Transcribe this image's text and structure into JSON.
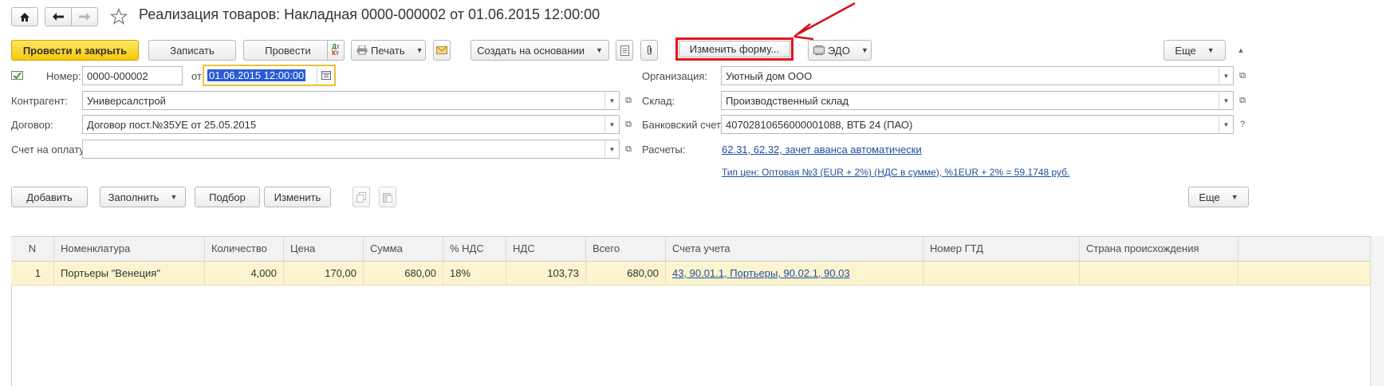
{
  "window": {
    "title": "Реализация товаров: Накладная 0000-000002 от 01.06.2015 12:00:00"
  },
  "toolbar": {
    "post_close": "Провести и закрыть",
    "save": "Записать",
    "post": "Провести",
    "print": "Печать",
    "create_based": "Создать на основании",
    "change_form": "Изменить форму...",
    "edo": "ЭДО",
    "more": "Еще"
  },
  "header": {
    "number_label": "Номер:",
    "number_value": "0000-000002",
    "date_label": "от:",
    "date_value": "01.06.2015 12:00:00",
    "contractor_label": "Контрагент:",
    "contractor_value": "Универсалстрой",
    "contract_label": "Договор:",
    "contract_value": "Договор пост.№35УЕ от 25.05.2015",
    "invoice_label": "Счет на оплату:",
    "invoice_value": "",
    "org_label": "Организация:",
    "org_value": "Уютный дом ООО",
    "warehouse_label": "Склад:",
    "warehouse_value": "Производственный склад",
    "bank_label": "Банковский счет:",
    "bank_value": "40702810656000001088, ВТБ 24 (ПАО)",
    "settlements_label": "Расчеты:",
    "settlements_link": "62.31, 62.32, зачет аванса автоматически",
    "price_type_link": "Тип цен: Оптовая №3 (EUR + 2%) (НДС в сумме), %1EUR + 2% = 59.1748 руб."
  },
  "table_toolbar": {
    "add": "Добавить",
    "fill": "Заполнить",
    "pick": "Подбор",
    "change": "Изменить",
    "more": "Еще"
  },
  "table": {
    "columns": [
      "N",
      "Номенклатура",
      "Количество",
      "Цена",
      "Сумма",
      "% НДС",
      "НДС",
      "Всего",
      "Счета учета",
      "Номер ГТД",
      "Страна происхождения"
    ],
    "rows": [
      {
        "n": "1",
        "item": "Портьеры \"Венеция\"",
        "qty": "4,000",
        "price": "170,00",
        "sum": "680,00",
        "vat_rate": "18%",
        "vat": "103,73",
        "total": "680,00",
        "accounts": "43, 90.01.1, Портьеры, 90.02.1, 90.03",
        "gtd": "",
        "country": ""
      }
    ]
  },
  "icons": {
    "home": "home-icon",
    "back": "arrow-left-icon",
    "forward": "arrow-right-icon",
    "favorite": "star-icon"
  },
  "colors": {
    "primary_button": "#f5c80a",
    "highlight_border": "#e0161e",
    "selected_row": "#fbf4cf",
    "link": "#1f4e9f"
  }
}
